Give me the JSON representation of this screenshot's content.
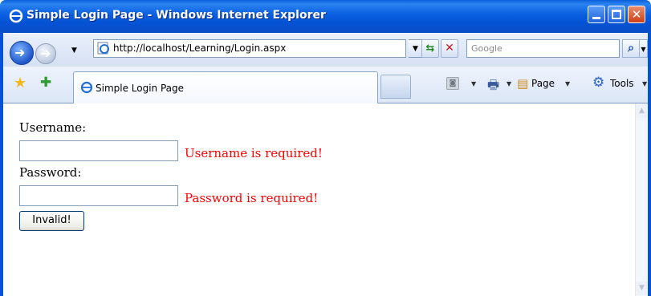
{
  "window": {
    "title": "Simple Login Page - Windows Internet Explorer"
  },
  "toolbar": {
    "address": "http://localhost/Learning/Login.aspx",
    "search_placeholder": "Google"
  },
  "tabs": [
    {
      "label": "Simple Login Page",
      "active": true
    }
  ],
  "command_bar": {
    "page_label": "Page",
    "tools_label": "Tools"
  },
  "form": {
    "username_label": "Username:",
    "username_value": "",
    "username_error": "Username is required!",
    "password_label": "Password:",
    "password_value": "",
    "password_error": "Password is required!",
    "submit_label": "Invalid!"
  },
  "colors": {
    "error": "#ff0000",
    "titlebar": "#0552d4"
  },
  "icons": [
    "ie-icon",
    "back-icon",
    "forward-icon",
    "refresh-icon",
    "stop-icon",
    "search-icon",
    "favorites-star-icon",
    "add-favorites-icon",
    "feeds-icon",
    "print-icon",
    "page-icon",
    "tools-gear-icon"
  ]
}
